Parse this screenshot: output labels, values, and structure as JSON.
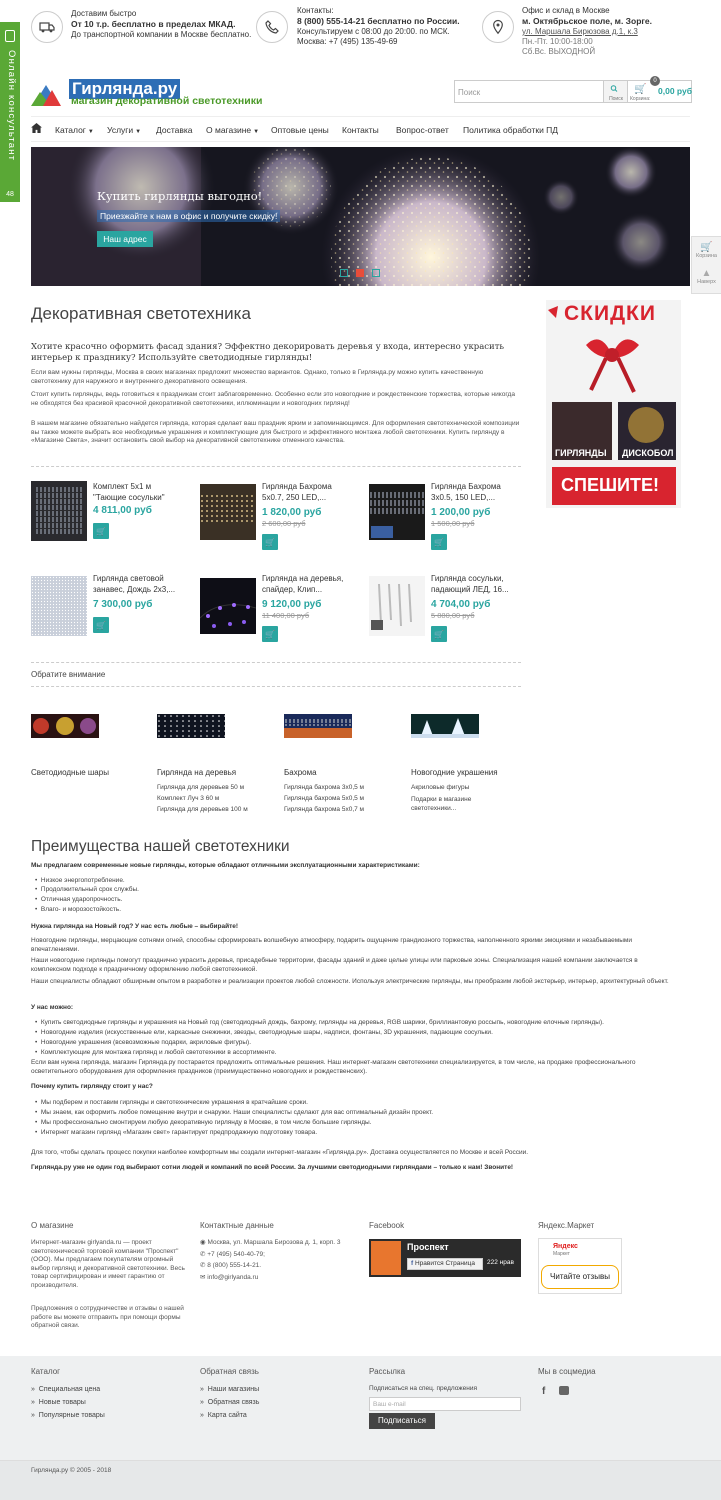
{
  "topbar": {
    "delivery": {
      "l1": "Доставим быстро",
      "l2": "От 10 т.р. бесплатно в пределах МКАД.",
      "l3": "До транспортной компании в Москве бесплатно."
    },
    "contacts": {
      "l1": "Контакты:",
      "l2": "8 (800) 555-14-21 бесплатно по России.",
      "l3": "Консультируем с 08:00 до 20:00. по МСК.",
      "l4": "Москва: +7 (495) 135-49-69"
    },
    "office": {
      "l1": "Офис и склад в Москве",
      "l2": "м. Октябрьское поле, м. Зорге.",
      "l3": "ул. Маршала Бирюзова д.1, к.3",
      "l4": "Пн.-Пт. 10:00-18:00",
      "l5": "Сб.Вс. ВЫХОДНОЙ"
    }
  },
  "consultant": {
    "label": "Онлайн консультант",
    "count": "48"
  },
  "side_tab": {
    "cart": "Корзина",
    "up": "Наверх"
  },
  "logo": {
    "name": "Гирлянда.ру",
    "tagline": "магазин декоративной светотехники"
  },
  "search": {
    "placeholder": "Поиск",
    "button_label": "Поиск"
  },
  "cart": {
    "count": "0",
    "sum": "0,00 руб",
    "label": "Корзина:"
  },
  "nav": [
    {
      "label": "Каталог"
    },
    {
      "label": "Услуги"
    },
    {
      "label": "Доставка"
    },
    {
      "label": "О магазине"
    },
    {
      "label": "Оптовые цены"
    },
    {
      "label": "Контакты"
    },
    {
      "label": "Вопрос-ответ"
    },
    {
      "label": "Политика обработки ПД"
    }
  ],
  "banner": {
    "title": "Купить гирлянды выгодно!",
    "subtitle": "Приезжайте к нам в офис и получите скидку!",
    "button": "Наш адрес"
  },
  "intro": {
    "title": "Декоративная светотехника",
    "lead": "Хотите красочно оформить фасад здания? Эффектно декорировать деревья у входа, интересно украсить интерьер к празднику? Используйте светодиодные гирлянды!",
    "p1": "Если вам нужны гирлянды, Москва в своих магазинах предложит множество вариантов. Однако, только в Гирлянда.ру можно купить качественную светотехнику для наружного и внутреннего декоративного освещения.",
    "p2": "Стоит купить гирлянды, ведь готовиться к праздникам стоит заблаговременно. Особенно если это новогодние и рождественские торжества, которые никогда не обходятся без красивой красочной декоративной светотехники, иллюминации и новогодних гирлянд!",
    "p3": "В нашем магазине обязательно найдется гирлянда, которая сделает ваш праздник ярким и запоминающимся. Для оформления светотехнической композиции вы также можете выбрать все необходимые украшения и комплектующие для быстрого и эффективного монтажа любой светотехники. Купить гирлянду в «Магазине Света», значит остановить свой выбор на декоративной светотехнике отменного качества."
  },
  "promo": {
    "title": "СКИДКИ",
    "tag1": "ГИРЛЯНДЫ",
    "tag2": "ДИСКОБОЛ",
    "cta": "СПЕШИТЕ!"
  },
  "products": [
    {
      "name": "Комплект 5х1 м \"Тающие сосульки\"",
      "price": "4 811,00 руб",
      "old": ""
    },
    {
      "name": "Гирлянда Бахрома 5х0.7, 250 LED,...",
      "price": "1 820,00 руб",
      "old": "2 600,00 руб"
    },
    {
      "name": "Гирлянда Бахрома 3х0.5, 150 LED,...",
      "price": "1 200,00 руб",
      "old": "1 500,00 руб"
    },
    {
      "name": "Гирлянда световой занавес, Дождь 2х3,...",
      "price": "7 300,00 руб",
      "old": ""
    },
    {
      "name": "Гирлянда на деревья, спайдер, Клип...",
      "price": "9 120,00 руб",
      "old": "11 400,00 руб"
    },
    {
      "name": "Гирлянда сосульки, падающий ЛЕД, 16...",
      "price": "4 704,00 руб",
      "old": "5 880,00 руб"
    }
  ],
  "attention": {
    "title": "Обратите внимание",
    "cats": [
      {
        "title": "Светодиодные шары",
        "items": []
      },
      {
        "title": "Гирлянда на деревья",
        "items": [
          "Гирлянда для деревьев 50 м",
          "Комплект Луч 3 60 м",
          "Гирлянда для деревьев 100 м"
        ]
      },
      {
        "title": "Бахрома",
        "items": [
          "Гирлянда бахрома 3х0,5 м",
          "Гирлянда бахрома 5х0,5 м",
          "Гирлянда бахрома 5х0,7 м"
        ]
      },
      {
        "title": "Новогодние украшения",
        "items": [
          "Акриловые фигуры",
          "Подарки в магазине светотехники..."
        ]
      }
    ]
  },
  "adv": {
    "title": "Преимущества нашей светотехники",
    "intro": "Мы предлагаем современные новые гирлянды, которые обладают отличными эксплуатационными характеристиками:",
    "bullets1": [
      "Низкое энергопотребление.",
      "Продолжительный срок службы.",
      "Отличная ударопрочность.",
      "Влаго- и морозостойкость."
    ],
    "q1": "Нужна гирлянда на Новый год? У нас есть любые – выбирайте!",
    "p1": "Новогодние гирлянды, мерцающие сотнями огней, способны сформировать волшебную атмосферу, подарить ощущение грандиозного торжества, наполненного яркими эмоциями и незабываемыми впечатлениями.",
    "p2": "Наши новогодние гирлянды помогут празднично украсить деревья, присадебные территории, фасады зданий и даже целые улицы или парковые зоны. Специализация нашей компании заключается в комплексном подходе к праздничному оформлению любой светотехникой.",
    "p3": "Наши специалисты обладают обширным опытом в разработке и реализации проектов любой сложности. Используя электрические гирлянды, мы преобразим любой экстерьер, интерьер, архитектурный объект.",
    "q2": "У нас можно:",
    "bullets2": [
      "Купить светодиодные гирлянды и украшения на Новый год (светодиодный дождь, бахрому, гирлянды на деревья, RGB шарики, бриллиантовую россыпь, новогодние елочные гирлянды).",
      "Новогодние изделия (искусственные ели, каркасные снежинки, звезды, светодиодные шары, надписи, фонтаны, 3D украшения, падающие сосульки.",
      "Новогодние украшения (всевозможные подарки, акриловые фигуры).",
      "Комплектующие для монтажа гирлянд и любой светотехники в ассортименте."
    ],
    "p4": "Если вам нужна гирлянда, магазин Гирлянда.ру постарается предложить оптимальные решения. Наш интернет-магазин светотехники специализируется, в том числе, на продаже профессионального осветительного оборудования для оформления праздников (преимущественно новогодних и рождественских).",
    "q3": "Почему купить гирлянду стоит у нас?",
    "bullets3": [
      "Мы подберем и поставим гирлянды и светотехнические украшения в кратчайшие сроки.",
      "Мы знаем, как оформить любое помещение внутри и снаружи. Наши специалисты сделают для вас оптимальный дизайн проект.",
      "Мы профессионально смонтируем любую декоративную гирлянду в Москве, в том числе большие гирлянды.",
      "Интернет магазин гирлянд «Магазин свет» гарантирует предпродажную подготовку товара."
    ],
    "p5": "Для того, чтобы сделать процесс покупки наиболее комфортным мы создали интернет-магазин «Гирлянда.ру». Доставка осуществляется по Москве и всей России.",
    "final": "Гирлянда.ру уже не один год выбирают сотни людей и компаний по всей России. За лучшими светодиодными гирляндами – только к нам! Звоните!"
  },
  "footer": {
    "about_title": "О магазине",
    "about_p1": "Интернет-магазин girlyanda.ru — проект светотехнической торговой компании \"Проспект\" (ООО). Мы предлагаем покупателям огромный выбор гирлянд и декоративной светотехники. Весь товар сертифицирован и имеет гарантию от производителя.",
    "about_p2": "Предложения о сотрудничестве и отзывы о нашей работе вы можете отправить при помощи формы обратной связи.",
    "contacts_title": "Контактные данные",
    "address": "Москва, ул. Маршала Бирозова д. 1, корп. 3",
    "phone1": "+7 (495) 540-40-79;",
    "phone2": "8 (800) 555-14-21.",
    "email": "info@girlyanda.ru",
    "fb_title": "Facebook",
    "fb_page": "Проспект",
    "fb_like": "Нравится Страница",
    "fb_count": "222 нрав",
    "ym_title": "Яндекс.Маркет",
    "ym_logo": "Яндекс",
    "ym_sub": "Маркет",
    "ym_btn": "Читайте отзывы"
  },
  "footer2": {
    "catalog_title": "Каталог",
    "catalog": [
      "Специальная цена",
      "Новые товары",
      "Популярные товары"
    ],
    "feedback_title": "Обратная связь",
    "feedback": [
      "Наши магазины",
      "Обратная связь",
      "Карта сайта"
    ],
    "news_title": "Рассылка",
    "news_text": "Подписаться на спец. предложения",
    "news_placeholder": "Ваш e-mail",
    "news_btn": "Подписаться",
    "social_title": "Мы в соцмедиа",
    "copyright": "Гирлянда.ру © 2005 - 2018"
  },
  "colors": {
    "accent": "#2aa5a0",
    "green": "#5aa836",
    "brand_blue": "#2d6db5",
    "promo_red": "#d8242f"
  }
}
